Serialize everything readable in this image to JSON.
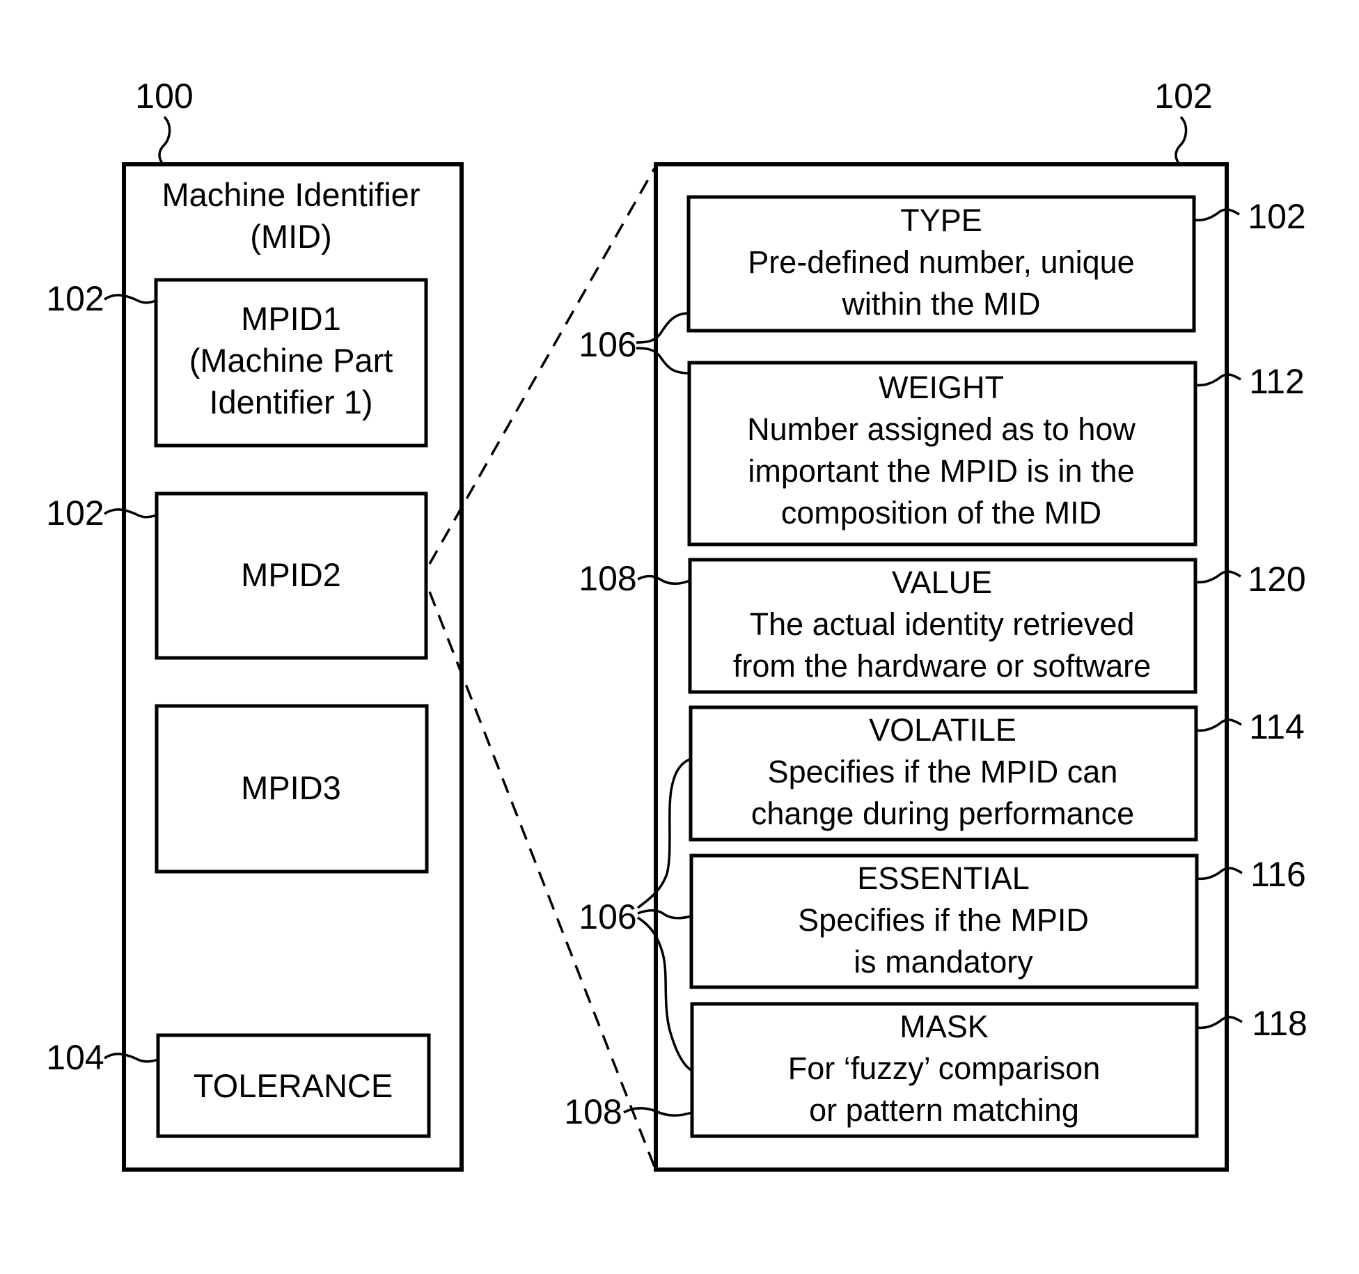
{
  "figure": {
    "left_panel": {
      "ref": "100",
      "title_lines": [
        "Machine Identifier",
        "(MID)"
      ],
      "items": [
        {
          "ref": "102",
          "lines": [
            "MPID1",
            "(Machine Part",
            "Identifier 1)"
          ]
        },
        {
          "ref": "102",
          "lines": [
            "MPID2"
          ]
        },
        {
          "ref": "",
          "lines": [
            "MPID3"
          ]
        },
        {
          "ref": "104",
          "lines": [
            "TOLERANCE"
          ]
        }
      ]
    },
    "right_panel": {
      "ref": "102",
      "fields": [
        {
          "ref": "102",
          "title": "TYPE",
          "desc": [
            "Pre-defined number, unique",
            "within the MID"
          ]
        },
        {
          "ref": "112",
          "title": "WEIGHT",
          "desc": [
            "Number assigned as to how",
            "important the MPID is in the",
            "composition of the MID"
          ]
        },
        {
          "ref": "120",
          "title": "VALUE",
          "desc": [
            "The actual identity retrieved",
            "from the hardware or software"
          ]
        },
        {
          "ref": "114",
          "title": "VOLATILE",
          "desc": [
            "Specifies if the MPID can",
            "change during performance"
          ]
        },
        {
          "ref": "116",
          "title": "ESSENTIAL",
          "desc": [
            "Specifies if the MPID",
            "is mandatory"
          ]
        },
        {
          "ref": "118",
          "title": "MASK",
          "desc": [
            "For ‘fuzzy’ comparison",
            "or pattern matching"
          ]
        }
      ],
      "group_refs": [
        {
          "ref": "106",
          "targets": [
            "TYPE",
            "WEIGHT"
          ]
        },
        {
          "ref": "108",
          "targets": [
            "VALUE"
          ]
        },
        {
          "ref": "106",
          "targets": [
            "VOLATILE",
            "ESSENTIAL",
            "MASK"
          ]
        },
        {
          "ref": "108",
          "targets": [
            "MASK"
          ]
        }
      ]
    }
  }
}
